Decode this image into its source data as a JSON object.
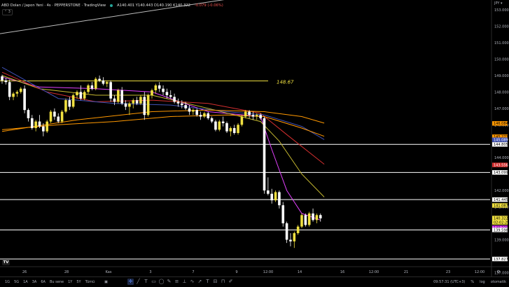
{
  "header": {
    "symbol": "ABD Doları / Japon Yeni · 4s · PEPPERSTONE · TradingView",
    "ohlc": "A140.401 Y140.443 D140.190 K140.322",
    "change": "-0.079 (-0.06%)",
    "collapse_label": "⌃ 3"
  },
  "colors": {
    "up": "#f0e040",
    "down": "#ffffff",
    "ma_fast": "#e040fb",
    "ma_mid": "#c5b830",
    "ma_slow": "#d32f2f",
    "ma_blue": "#3f51b5",
    "ma_orange": "#ff9800",
    "trend": "#bdbdbd"
  },
  "chart_data": {
    "type": "candlestick",
    "ylim": [
      137.4,
      153.6
    ],
    "currency_label": "JPY ▾",
    "y_ticks": [
      153.0,
      152.0,
      151.0,
      150.0,
      149.0,
      148.0,
      147.0,
      146.0,
      144.0,
      142.0,
      141.0,
      139.0,
      137.0
    ],
    "x_ticks": [
      "26",
      "28",
      "Kas",
      "3",
      "7",
      "9",
      "12:00",
      "14",
      "16",
      "12:00",
      "21",
      "23",
      "12:00"
    ],
    "horizontal_levels": [
      {
        "price": 148.67,
        "label": "148.67",
        "color": "#f0e040"
      },
      {
        "price": 144.805,
        "color": "#ffffff"
      },
      {
        "price": 143.099,
        "color": "#ffffff"
      },
      {
        "price": 141.445,
        "color": "#ffffff"
      },
      {
        "price": 139.598,
        "color": "#ffffff"
      },
      {
        "price": 137.827,
        "color": "#ffffff"
      }
    ],
    "price_tags": [
      {
        "price": 146.084,
        "label": "146.084",
        "bg": "#ff9800",
        "fg": "#000000"
      },
      {
        "price": 145.273,
        "label": "145.273",
        "bg": "#ff9800",
        "fg": "#000000"
      },
      {
        "price": 145.089,
        "label": "145.089",
        "bg": "#3f51b5",
        "fg": "#ffffff"
      },
      {
        "price": 144.805,
        "label": "144.805",
        "bg": "#ffffff",
        "fg": "#000000"
      },
      {
        "price": 143.556,
        "label": "143.556",
        "bg": "#d32f2f",
        "fg": "#ffffff"
      },
      {
        "price": 143.099,
        "label": "143.099",
        "bg": "#ffffff",
        "fg": "#000000"
      },
      {
        "price": 141.445,
        "label": "141.445",
        "bg": "#ffffff",
        "fg": "#000000"
      },
      {
        "price": 141.087,
        "label": "141.087",
        "bg": "#f0e040",
        "fg": "#000000"
      },
      {
        "price": 140.322,
        "label": "140.322",
        "bg": "#f0e040",
        "fg": "#000000"
      },
      {
        "price": 140.055,
        "label": "02:02:29",
        "bg": "#f0e040",
        "fg": "#000000"
      },
      {
        "price": 139.729,
        "label": "140.229",
        "bg": "#e040fb",
        "fg": "#000000"
      },
      {
        "price": 139.598,
        "label": "139.598",
        "bg": "#ffffff",
        "fg": "#000000"
      },
      {
        "price": 137.827,
        "label": "137.827",
        "bg": "#ffffff",
        "fg": "#000000"
      }
    ],
    "trendline": {
      "from": [
        0,
        151.55
      ],
      "to": [
        1090,
        158.6
      ]
    },
    "candles": [
      [
        148.95,
        149.05,
        148.5,
        148.7
      ],
      [
        148.7,
        148.85,
        148.45,
        148.6
      ],
      [
        148.6,
        148.75,
        147.5,
        147.7
      ],
      [
        147.7,
        148.0,
        147.5,
        147.9
      ],
      [
        147.9,
        148.1,
        147.7,
        148.0
      ],
      [
        148.0,
        148.3,
        147.9,
        148.2
      ],
      [
        148.2,
        148.4,
        146.7,
        146.9
      ],
      [
        146.9,
        147.0,
        146.2,
        146.4
      ],
      [
        146.4,
        146.6,
        145.7,
        145.8
      ],
      [
        145.8,
        146.3,
        145.6,
        146.2
      ],
      [
        146.2,
        146.6,
        145.8,
        145.9
      ],
      [
        145.9,
        146.1,
        145.3,
        145.6
      ],
      [
        145.6,
        146.3,
        145.5,
        146.2
      ],
      [
        146.2,
        146.9,
        146.1,
        146.8
      ],
      [
        146.8,
        147.0,
        146.3,
        146.5
      ],
      [
        146.5,
        146.7,
        146.1,
        146.2
      ],
      [
        146.2,
        146.9,
        146.1,
        146.8
      ],
      [
        146.8,
        147.6,
        146.7,
        147.5
      ],
      [
        147.5,
        147.7,
        146.9,
        147.1
      ],
      [
        147.1,
        147.9,
        147.0,
        147.8
      ],
      [
        147.8,
        148.1,
        147.6,
        148.0
      ],
      [
        148.0,
        148.4,
        147.5,
        147.6
      ],
      [
        147.6,
        148.1,
        147.5,
        148.0
      ],
      [
        148.0,
        148.5,
        147.9,
        148.4
      ],
      [
        148.4,
        148.6,
        148.1,
        148.2
      ],
      [
        148.2,
        148.9,
        148.1,
        148.8
      ],
      [
        148.8,
        149.0,
        148.6,
        148.7
      ],
      [
        148.7,
        148.9,
        148.4,
        148.5
      ],
      [
        148.5,
        148.7,
        148.3,
        148.6
      ],
      [
        148.6,
        148.7,
        147.4,
        147.6
      ],
      [
        147.6,
        147.8,
        147.2,
        147.4
      ],
      [
        147.4,
        148.2,
        147.3,
        148.1
      ],
      [
        148.1,
        148.3,
        147.2,
        147.3
      ],
      [
        147.3,
        147.5,
        146.9,
        147.1
      ],
      [
        147.1,
        147.4,
        146.6,
        147.3
      ],
      [
        147.3,
        147.6,
        147.0,
        147.5
      ],
      [
        147.5,
        147.7,
        147.2,
        147.3
      ],
      [
        147.3,
        147.8,
        147.2,
        147.7
      ],
      [
        147.7,
        148.0,
        146.3,
        146.6
      ],
      [
        146.6,
        147.9,
        146.5,
        147.8
      ],
      [
        147.8,
        148.2,
        147.6,
        148.1
      ],
      [
        148.1,
        148.5,
        147.9,
        148.4
      ],
      [
        148.4,
        148.6,
        148.0,
        148.2
      ],
      [
        148.2,
        148.4,
        147.8,
        148.0
      ],
      [
        148.0,
        148.2,
        147.6,
        147.8
      ],
      [
        147.8,
        148.1,
        147.6,
        147.7
      ],
      [
        147.7,
        147.9,
        147.3,
        147.4
      ],
      [
        147.4,
        147.6,
        147.1,
        147.3
      ],
      [
        147.3,
        147.5,
        147.0,
        147.2
      ],
      [
        147.2,
        147.4,
        146.9,
        147.0
      ],
      [
        147.0,
        147.2,
        146.6,
        146.8
      ],
      [
        146.8,
        147.0,
        146.6,
        146.9
      ],
      [
        146.9,
        147.0,
        146.5,
        146.6
      ],
      [
        146.6,
        146.8,
        146.3,
        146.5
      ],
      [
        146.5,
        146.8,
        146.4,
        146.7
      ],
      [
        146.7,
        146.8,
        146.3,
        146.4
      ],
      [
        146.4,
        146.5,
        146.1,
        146.2
      ],
      [
        146.2,
        146.3,
        145.6,
        145.7
      ],
      [
        145.7,
        146.3,
        145.6,
        146.2
      ],
      [
        146.2,
        146.5,
        145.9,
        146.1
      ],
      [
        146.1,
        146.2,
        145.5,
        145.6
      ],
      [
        145.6,
        145.9,
        145.3,
        145.8
      ],
      [
        145.8,
        146.0,
        145.4,
        145.5
      ],
      [
        145.5,
        146.1,
        145.4,
        146.0
      ],
      [
        146.0,
        146.6,
        145.9,
        146.5
      ],
      [
        146.5,
        146.9,
        146.4,
        146.8
      ],
      [
        146.8,
        146.9,
        146.4,
        146.6
      ],
      [
        146.6,
        146.8,
        146.3,
        146.5
      ],
      [
        146.5,
        146.7,
        146.3,
        146.6
      ],
      [
        146.6,
        146.7,
        146.3,
        146.4
      ],
      [
        146.4,
        146.5,
        141.8,
        142.0
      ],
      [
        142.0,
        142.8,
        141.7,
        141.8
      ],
      [
        141.8,
        142.1,
        141.2,
        141.4
      ],
      [
        141.4,
        142.0,
        141.3,
        141.9
      ],
      [
        141.9,
        142.0,
        140.9,
        141.1
      ],
      [
        141.1,
        141.3,
        139.8,
        140.0
      ],
      [
        140.0,
        140.1,
        138.8,
        139.0
      ],
      [
        139.0,
        139.4,
        138.6,
        138.9
      ],
      [
        138.9,
        139.5,
        138.5,
        139.4
      ],
      [
        139.4,
        139.9,
        139.3,
        139.8
      ],
      [
        139.8,
        140.6,
        139.7,
        140.5
      ],
      [
        140.5,
        140.6,
        139.8,
        139.9
      ],
      [
        139.9,
        140.7,
        139.8,
        140.6
      ],
      [
        140.6,
        140.9,
        140.1,
        140.2
      ],
      [
        140.2,
        140.6,
        140.0,
        140.5
      ],
      [
        140.5,
        140.6,
        140.1,
        140.3
      ]
    ],
    "moving_averages": [
      {
        "name": "ma_fast",
        "color": "#e040fb",
        "values": [
          [
            0,
            148.9
          ],
          [
            10,
            148.3
          ],
          [
            25,
            148.2
          ],
          [
            40,
            148.0
          ],
          [
            55,
            146.8
          ],
          [
            69,
            146.5
          ],
          [
            72,
            144.5
          ],
          [
            76,
            142.0
          ],
          [
            80,
            140.6
          ],
          [
            85,
            140.2
          ]
        ]
      },
      {
        "name": "ma_mid",
        "color": "#c5b830",
        "values": [
          [
            0,
            149.0
          ],
          [
            10,
            148.2
          ],
          [
            25,
            147.8
          ],
          [
            40,
            147.8
          ],
          [
            55,
            147.0
          ],
          [
            69,
            146.2
          ],
          [
            74,
            145.0
          ],
          [
            80,
            143.0
          ],
          [
            86,
            141.6
          ]
        ]
      },
      {
        "name": "ma_slow",
        "color": "#d32f2f",
        "values": [
          [
            0,
            149.2
          ],
          [
            12,
            148.0
          ],
          [
            25,
            147.4
          ],
          [
            40,
            147.5
          ],
          [
            55,
            147.3
          ],
          [
            69,
            146.7
          ],
          [
            76,
            145.4
          ],
          [
            86,
            143.6
          ]
        ]
      },
      {
        "name": "ma_blue",
        "color": "#3f51b5",
        "values": [
          [
            0,
            149.5
          ],
          [
            15,
            147.6
          ],
          [
            30,
            147.3
          ],
          [
            45,
            147.2
          ],
          [
            60,
            146.8
          ],
          [
            70,
            146.6
          ],
          [
            80,
            145.9
          ],
          [
            86,
            145.1
          ]
        ]
      },
      {
        "name": "ma_orange",
        "color": "#ff9800",
        "values": [
          [
            0,
            145.7
          ],
          [
            15,
            146.0
          ],
          [
            30,
            146.2
          ],
          [
            45,
            146.5
          ],
          [
            60,
            146.6
          ],
          [
            70,
            146.5
          ],
          [
            80,
            145.8
          ],
          [
            86,
            145.3
          ]
        ]
      },
      {
        "name": "ma_orange2",
        "color": "#ff9800",
        "values": [
          [
            0,
            145.6
          ],
          [
            20,
            146.3
          ],
          [
            40,
            146.8
          ],
          [
            55,
            146.9
          ],
          [
            70,
            146.8
          ],
          [
            80,
            146.5
          ],
          [
            86,
            146.1
          ]
        ]
      }
    ]
  },
  "bottombar": {
    "timeframes": [
      "1G",
      "5G",
      "1A",
      "3A",
      "6A",
      "Bu sene",
      "1Y",
      "5Y",
      "Tümü"
    ],
    "clock": "09:57:31 (UTC+3)",
    "percent": "%",
    "log": "log",
    "auto": "otomatik",
    "tools": [
      "crosshair-icon",
      "line-icon",
      "text-icon",
      "rect-icon",
      "ellipse-icon",
      "brush-icon",
      "fib-icon",
      "ruler-icon",
      "wave-icon",
      "arrow-icon",
      "text2-icon",
      "measure-icon",
      "magnet-icon",
      "pencil-icon"
    ]
  }
}
